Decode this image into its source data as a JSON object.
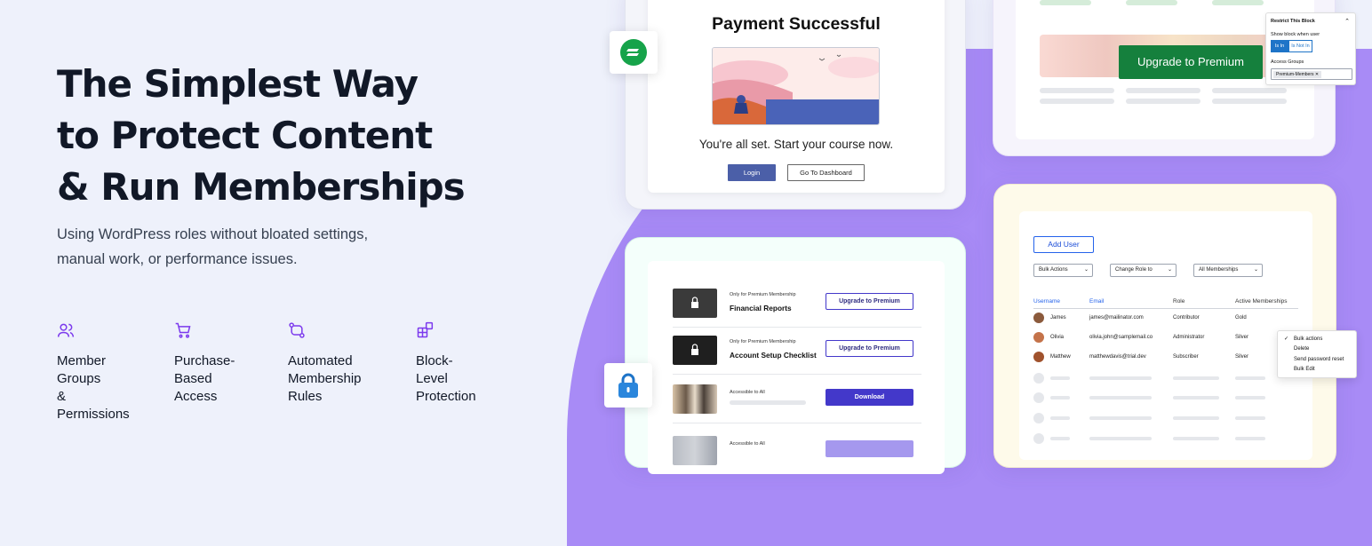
{
  "hero": {
    "title_lines": [
      "The Simplest Way",
      "to Protect Content",
      "& Run Memberships"
    ],
    "subtitle_lines": [
      "Using WordPress roles without bloated settings,",
      "manual work, or performance issues."
    ]
  },
  "features": [
    {
      "icon": "users-icon",
      "line1": "Member Groups",
      "line2": "& Permissions"
    },
    {
      "icon": "cart-icon",
      "line1": "Purchase-",
      "line2": "Based Access"
    },
    {
      "icon": "workflow-icon",
      "line1": "Automated",
      "line2": "Membership Rules"
    },
    {
      "icon": "blocks-icon",
      "line1": "Block-Level",
      "line2": "Protection"
    }
  ],
  "payment": {
    "title": "Payment Successful",
    "message": "You're all set. Start your course now.",
    "login_label": "Login",
    "dashboard_label": "Go To Dashboard"
  },
  "upgrade": {
    "button_label": "Upgrade to Premium"
  },
  "restrict_panel": {
    "title": "Restrict This Block",
    "show_label": "Show block when user",
    "is_in": "Is In",
    "is_not_in": "Is Not In",
    "access_groups_label": "Access Groups",
    "tag": "Premium-Members"
  },
  "downloads": [
    {
      "note": "Only for Premium Membership",
      "title": "Financial Reports",
      "action": "Upgrade to Premium"
    },
    {
      "note": "Only for Premium Membership",
      "title": "Account Setup Checklist",
      "action": "Upgrade to Premium"
    },
    {
      "note": "Accessible to All",
      "title": "",
      "action": "Download"
    },
    {
      "note": "Accessible to All",
      "title": "",
      "action": ""
    }
  ],
  "users": {
    "add_user": "Add User",
    "filters": [
      "Bulk Actions",
      "Change Role to",
      "All Memberships"
    ],
    "columns": [
      "Username",
      "Email",
      "Role",
      "Active Memberships"
    ],
    "rows": [
      {
        "name": "James",
        "email": "james@mailinator.com",
        "role": "Contributor",
        "membership": "Gold"
      },
      {
        "name": "Olivia",
        "email": "olivia.john@samplemail.co",
        "role": "Administrator",
        "membership": "Silver"
      },
      {
        "name": "Matthew",
        "email": "matthewdavis@trial.dev",
        "role": "Subscriber",
        "membership": "Silver"
      }
    ],
    "bulk_menu": [
      "Bulk actions",
      "Delete",
      "Send password reset",
      "Bulk Edit"
    ]
  },
  "colors": {
    "accent": "#7c3aed",
    "blob": "#a88bf6",
    "upgrade_green": "#15803d",
    "indigo": "#4338ca"
  }
}
